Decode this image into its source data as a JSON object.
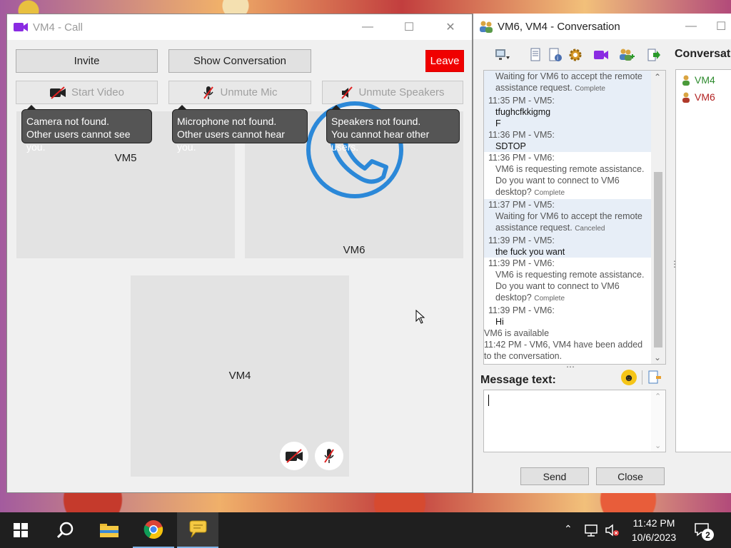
{
  "call_window": {
    "title": "VM4 - Call",
    "buttons": {
      "invite": "Invite",
      "show_conversation": "Show Conversation",
      "leave": "Leave",
      "start_video": "Start Video",
      "unmute_mic": "Unmute Mic",
      "unmute_speakers": "Unmute Speakers"
    },
    "tips": {
      "camera": [
        "Camera not found.",
        "Other users cannot see you."
      ],
      "mic": [
        "Microphone not found.",
        "Other users cannot hear you."
      ],
      "speakers": [
        "Speakers not found.",
        "You cannot hear other users."
      ]
    },
    "participants": {
      "vm5": "VM5",
      "vm6": "VM6",
      "vm4": "VM4"
    }
  },
  "conversation_window": {
    "title": "VM6, VM4 - Conversation",
    "panel_header": "Conversat",
    "participants": [
      {
        "name": "VM4",
        "color": "#2e8b2e"
      },
      {
        "name": "VM6",
        "color": "#b22222"
      }
    ],
    "messages": [
      {
        "header": "",
        "body": [
          "Waiting for VM6 to accept the remote",
          "assistance request."
        ],
        "status": "Complete",
        "dark": false,
        "selected": true
      },
      {
        "header": "11:35 PM - VM5:",
        "body": [
          "tfughcfkkigmg",
          "F"
        ],
        "status": "",
        "dark": true,
        "selected": true
      },
      {
        "header": "11:36 PM - VM5:",
        "body": [
          "SDTOP"
        ],
        "status": "",
        "dark": true,
        "selected": true
      },
      {
        "header": "11:36 PM - VM6:",
        "body": [
          "VM6 is requesting remote assistance.",
          "Do you want to connect to VM6",
          "desktop?"
        ],
        "status": "Complete",
        "dark": false,
        "selected": false
      },
      {
        "header": "11:37 PM - VM5:",
        "body": [
          "Waiting for VM6 to accept the remote",
          "assistance request."
        ],
        "status": "Canceled",
        "dark": false,
        "selected": true
      },
      {
        "header": "11:39 PM - VM5:",
        "body": [
          "the fuck you want"
        ],
        "status": "",
        "dark": true,
        "selected": true
      },
      {
        "header": "11:39 PM - VM6:",
        "body": [
          "VM6 is requesting remote assistance.",
          "Do you want to connect to VM6",
          "desktop?"
        ],
        "status": "Complete",
        "dark": false,
        "selected": false
      },
      {
        "header": "11:39 PM - VM6:",
        "body": [
          "Hi"
        ],
        "status": "",
        "dark": true,
        "selected": false
      }
    ],
    "system_lines": [
      "VM6 is available",
      "11:42 PM - VM6, VM4 have been added",
      "to the conversation."
    ],
    "message_label": "Message text:",
    "send": "Send",
    "close": "Close"
  },
  "taskbar": {
    "time": "11:42 PM",
    "date": "10/6/2023",
    "notification_count": "2"
  }
}
